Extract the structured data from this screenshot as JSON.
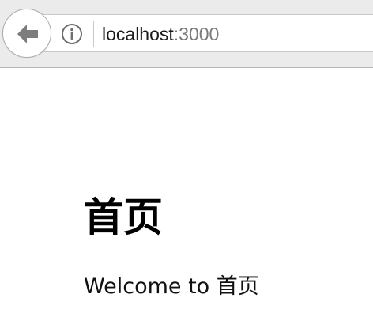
{
  "browser": {
    "url_host": "localhost",
    "url_port": ":3000"
  },
  "page": {
    "heading": "首页",
    "welcome_text": "Welcome to 首页"
  },
  "colors": {
    "toolbar_bg": "#ebebeb",
    "port_text": "#7a7a7a"
  }
}
